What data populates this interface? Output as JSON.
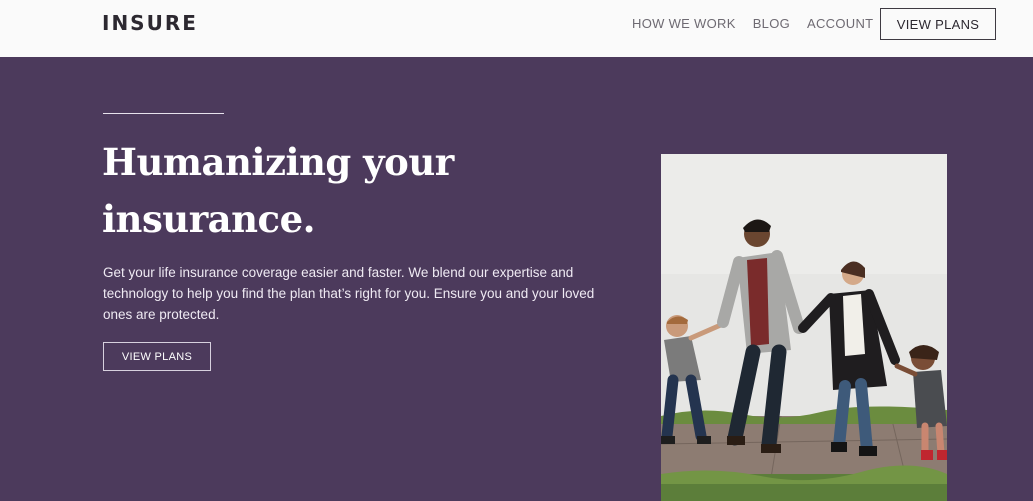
{
  "header": {
    "logo": "INSURE",
    "nav": [
      "HOW WE WORK",
      "BLOG",
      "ACCOUNT"
    ],
    "cta_label": "VIEW PLANS"
  },
  "hero": {
    "headline_lines": [
      "Humanizing your",
      "insurance."
    ],
    "description_lines": [
      "Get your life insurance coverage easier and faster. We blend our expertise and",
      "technology to help you find the plan that’s right for you. Ensure you and your loved",
      "ones are protected."
    ],
    "cta_label": "VIEW PLANS",
    "image": "family-walking-photo"
  },
  "colors": {
    "hero_bg": "#4c3a5c",
    "header_bg": "#fafafa",
    "text_dark": "#2c2830",
    "nav_gray": "#6e6a72"
  }
}
